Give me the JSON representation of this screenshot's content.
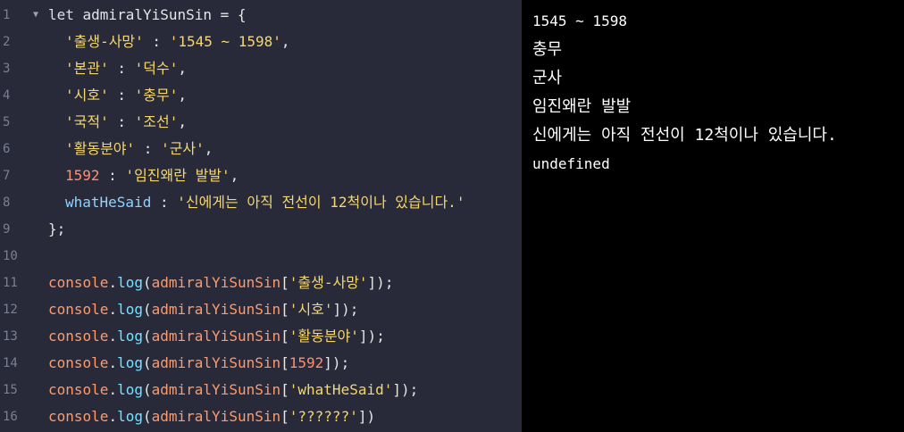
{
  "editor": {
    "lines": [
      {
        "no": "1",
        "parts": [
          [
            "kw",
            "let "
          ],
          [
            "plain",
            "admiralYiSunSin = {"
          ]
        ]
      },
      {
        "no": "2",
        "parts": [
          [
            "ind",
            ""
          ],
          [
            "str",
            "'출생-사망'"
          ],
          [
            "plain",
            " : "
          ],
          [
            "str",
            "'1545 ~ 1598'"
          ],
          [
            "plain",
            ","
          ]
        ]
      },
      {
        "no": "3",
        "parts": [
          [
            "ind",
            ""
          ],
          [
            "str",
            "'본관'"
          ],
          [
            "plain",
            " : "
          ],
          [
            "str",
            "'덕수'"
          ],
          [
            "plain",
            ","
          ]
        ]
      },
      {
        "no": "4",
        "parts": [
          [
            "ind",
            ""
          ],
          [
            "str",
            "'시호'"
          ],
          [
            "plain",
            " : "
          ],
          [
            "str",
            "'충무'"
          ],
          [
            "plain",
            ","
          ]
        ]
      },
      {
        "no": "5",
        "parts": [
          [
            "ind",
            ""
          ],
          [
            "str",
            "'국적'"
          ],
          [
            "plain",
            " : "
          ],
          [
            "str",
            "'조선'"
          ],
          [
            "plain",
            ","
          ]
        ]
      },
      {
        "no": "6",
        "parts": [
          [
            "ind",
            ""
          ],
          [
            "str",
            "'활동분야'"
          ],
          [
            "plain",
            " : "
          ],
          [
            "str",
            "'군사'"
          ],
          [
            "plain",
            ","
          ]
        ]
      },
      {
        "no": "7",
        "parts": [
          [
            "ind",
            ""
          ],
          [
            "num",
            "1592"
          ],
          [
            "plain",
            " : "
          ],
          [
            "str",
            "'임진왜란 발발'"
          ],
          [
            "plain",
            ","
          ]
        ]
      },
      {
        "no": "8",
        "parts": [
          [
            "ind",
            ""
          ],
          [
            "prop",
            "whatHeSaid"
          ],
          [
            "plain",
            " : "
          ],
          [
            "str",
            "'신에게는 아직 전선이 12척이나 있습니다.'"
          ]
        ]
      },
      {
        "no": "9",
        "parts": [
          [
            "plain",
            "};"
          ]
        ]
      },
      {
        "no": "10",
        "parts": []
      },
      {
        "no": "11",
        "parts": [
          [
            "fn",
            "console"
          ],
          [
            "plain",
            "."
          ],
          [
            "call",
            "log"
          ],
          [
            "plain",
            "("
          ],
          [
            "fn",
            "admiralYiSunSin"
          ],
          [
            "plain",
            "["
          ],
          [
            "str",
            "'출생-사망'"
          ],
          [
            "plain",
            "]);"
          ]
        ]
      },
      {
        "no": "12",
        "parts": [
          [
            "fn",
            "console"
          ],
          [
            "plain",
            "."
          ],
          [
            "call",
            "log"
          ],
          [
            "plain",
            "("
          ],
          [
            "fn",
            "admiralYiSunSin"
          ],
          [
            "plain",
            "["
          ],
          [
            "str",
            "'시호'"
          ],
          [
            "plain",
            "]);"
          ]
        ]
      },
      {
        "no": "13",
        "parts": [
          [
            "fn",
            "console"
          ],
          [
            "plain",
            "."
          ],
          [
            "call",
            "log"
          ],
          [
            "plain",
            "("
          ],
          [
            "fn",
            "admiralYiSunSin"
          ],
          [
            "plain",
            "["
          ],
          [
            "str",
            "'활동분야'"
          ],
          [
            "plain",
            "]);"
          ]
        ]
      },
      {
        "no": "14",
        "parts": [
          [
            "fn",
            "console"
          ],
          [
            "plain",
            "."
          ],
          [
            "call",
            "log"
          ],
          [
            "plain",
            "("
          ],
          [
            "fn",
            "admiralYiSunSin"
          ],
          [
            "plain",
            "["
          ],
          [
            "num",
            "1592"
          ],
          [
            "plain",
            "]);"
          ]
        ]
      },
      {
        "no": "15",
        "parts": [
          [
            "fn",
            "console"
          ],
          [
            "plain",
            "."
          ],
          [
            "call",
            "log"
          ],
          [
            "plain",
            "("
          ],
          [
            "fn",
            "admiralYiSunSin"
          ],
          [
            "plain",
            "["
          ],
          [
            "str",
            "'whatHeSaid'"
          ],
          [
            "plain",
            "]);"
          ]
        ]
      },
      {
        "no": "16",
        "parts": [
          [
            "fn",
            "console"
          ],
          [
            "plain",
            "."
          ],
          [
            "call",
            "log"
          ],
          [
            "plain",
            "("
          ],
          [
            "fn",
            "admiralYiSunSin"
          ],
          [
            "plain",
            "["
          ],
          [
            "str",
            "'??????'"
          ],
          [
            "plain",
            "])"
          ]
        ]
      }
    ],
    "fold_icon": "fold-triangle-icon"
  },
  "output": {
    "lines": [
      "1545 ~ 1598",
      "충무",
      "군사",
      "임진왜란 발발",
      "신에게는 아직 전선이 12척이나 있습니다.",
      "undefined"
    ]
  },
  "colors": {
    "editor_bg": "#282a3a",
    "output_bg": "#000000",
    "string": "#f5d76e",
    "number": "#ff8f72",
    "property": "#8fd3ff",
    "identifier": "#ff9a6b",
    "method": "#78e0ff"
  }
}
